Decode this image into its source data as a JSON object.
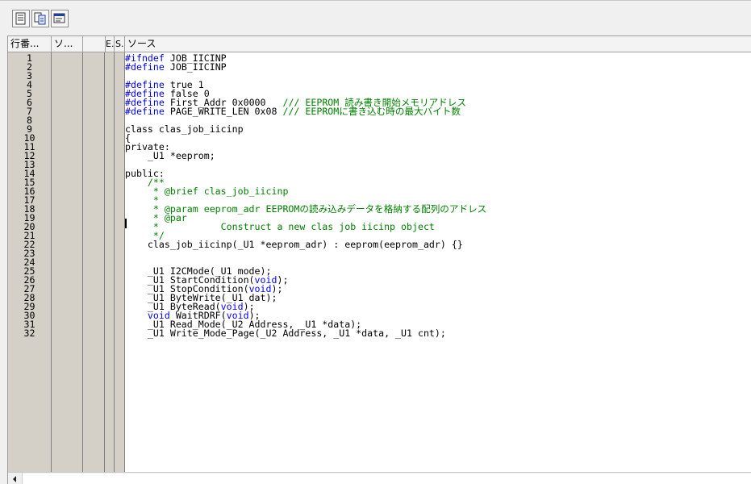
{
  "toolbar": {
    "buttons": [
      {
        "name": "source-view-icon"
      },
      {
        "name": "mixed-view-icon"
      },
      {
        "name": "disassembly-view-icon"
      }
    ]
  },
  "columns": {
    "line_no": "行番...",
    "source_addr": "ソ...",
    "event": "E...",
    "status": "S...",
    "source": "ソース"
  },
  "lines": [
    {
      "no": "1",
      "parts": [
        {
          "t": "#ifndef",
          "c": "kw"
        },
        {
          "t": " JOB_IICINP"
        }
      ]
    },
    {
      "no": "2",
      "parts": [
        {
          "t": "#define",
          "c": "kw"
        },
        {
          "t": " JOB_IICINP"
        }
      ]
    },
    {
      "no": "3",
      "parts": []
    },
    {
      "no": "4",
      "parts": [
        {
          "t": "#define",
          "c": "kw"
        },
        {
          "t": " true 1"
        }
      ]
    },
    {
      "no": "5",
      "parts": [
        {
          "t": "#define",
          "c": "kw"
        },
        {
          "t": " false 0"
        }
      ]
    },
    {
      "no": "6",
      "parts": [
        {
          "t": "#define",
          "c": "kw"
        },
        {
          "t": " First_Addr 0x0000   "
        },
        {
          "t": "/// EEPROM 読み書き開始メモリアドレス",
          "c": "cm"
        }
      ]
    },
    {
      "no": "7",
      "parts": [
        {
          "t": "#define",
          "c": "kw"
        },
        {
          "t": " PAGE_WRITE_LEN 0x08 "
        },
        {
          "t": "/// EEPROMに書き込む時の最大バイト数",
          "c": "cm"
        }
      ]
    },
    {
      "no": "8",
      "parts": []
    },
    {
      "no": "9",
      "parts": [
        {
          "t": "class clas_job_iicinp"
        }
      ]
    },
    {
      "no": "10",
      "parts": [
        {
          "t": "{"
        }
      ]
    },
    {
      "no": "11",
      "parts": [
        {
          "t": "private:"
        }
      ]
    },
    {
      "no": "12",
      "parts": [
        {
          "t": "    _U1 *eeprom;"
        }
      ]
    },
    {
      "no": "13",
      "parts": []
    },
    {
      "no": "14",
      "parts": [
        {
          "t": "public:"
        }
      ]
    },
    {
      "no": "15",
      "parts": [
        {
          "t": "    /**",
          "c": "cm"
        }
      ]
    },
    {
      "no": "16",
      "parts": [
        {
          "t": "     * @brief clas_job_iicinp",
          "c": "cm"
        }
      ]
    },
    {
      "no": "17",
      "parts": [
        {
          "t": "     *",
          "c": "cm"
        }
      ]
    },
    {
      "no": "18",
      "parts": [
        {
          "t": "     * @param eeprom_adr EEPROMの読み込みデータを格納する配列のアドレス",
          "c": "cm"
        }
      ]
    },
    {
      "no": "19",
      "parts": [
        {
          "t": "     * @par",
          "c": "cm"
        }
      ]
    },
    {
      "no": "20",
      "parts": [
        {
          "t": "     *           Construct a new clas job iicinp object",
          "c": "cm"
        }
      ]
    },
    {
      "no": "21",
      "parts": [
        {
          "t": "     */",
          "c": "cm"
        }
      ]
    },
    {
      "no": "22",
      "parts": [
        {
          "t": "    clas_job_iicinp(_U1 *eeprom_adr) : eeprom(eeprom_adr) {}"
        }
      ]
    },
    {
      "no": "23",
      "parts": []
    },
    {
      "no": "24",
      "parts": []
    },
    {
      "no": "25",
      "parts": [
        {
          "t": "    _U1 I2CMode(_U1 mode);"
        }
      ]
    },
    {
      "no": "26",
      "parts": [
        {
          "t": "    _U1 StartCondition("
        },
        {
          "t": "void",
          "c": "kw"
        },
        {
          "t": ");"
        }
      ]
    },
    {
      "no": "27",
      "parts": [
        {
          "t": "    _U1 StopCondition("
        },
        {
          "t": "void",
          "c": "kw"
        },
        {
          "t": ");"
        }
      ]
    },
    {
      "no": "28",
      "parts": [
        {
          "t": "    _U1 ByteWrite(_U1 dat);"
        }
      ]
    },
    {
      "no": "29",
      "parts": [
        {
          "t": "    _U1 ByteRead("
        },
        {
          "t": "void",
          "c": "kw"
        },
        {
          "t": ");"
        }
      ]
    },
    {
      "no": "30",
      "parts": [
        {
          "t": "    "
        },
        {
          "t": "void",
          "c": "kw"
        },
        {
          "t": " WaitRDRF("
        },
        {
          "t": "void",
          "c": "kw"
        },
        {
          "t": ");"
        }
      ]
    },
    {
      "no": "31",
      "parts": [
        {
          "t": "    _U1 Read_Mode(_U2 Address, _U1 *data);"
        }
      ]
    },
    {
      "no": "32",
      "parts": [
        {
          "t": "    _U1 Write_Mode_Page(_U2 Address, _U1 *data, _U1 cnt);"
        }
      ]
    }
  ]
}
